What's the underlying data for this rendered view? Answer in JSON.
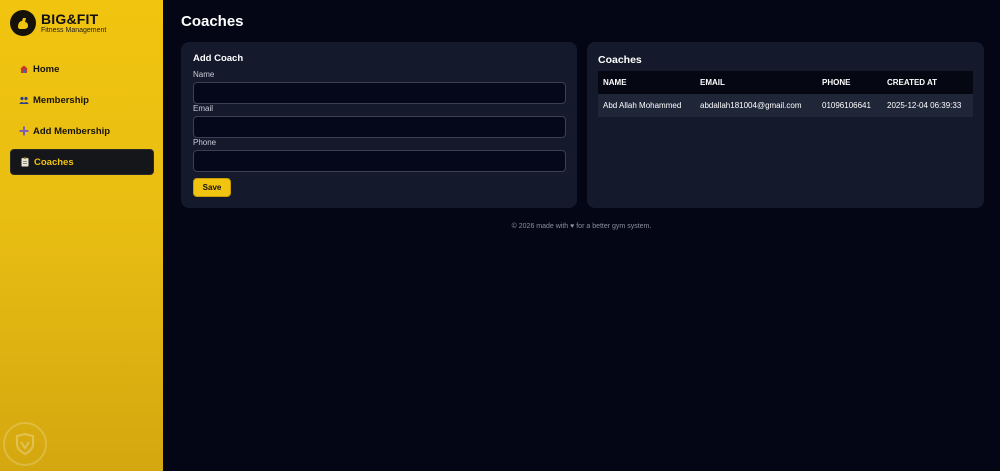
{
  "brand": {
    "title": "BIG&FIT",
    "subtitle": "Fitness Management"
  },
  "sidebar": {
    "items": [
      {
        "label": "Home",
        "icon": "house-icon",
        "active": false
      },
      {
        "label": "Membership",
        "icon": "members-icon",
        "active": false
      },
      {
        "label": "Add Membership",
        "icon": "plus-icon",
        "active": false
      },
      {
        "label": "Coaches",
        "icon": "clipboard-icon",
        "active": true
      }
    ]
  },
  "page": {
    "title": "Coaches"
  },
  "form": {
    "title": "Add Coach",
    "fields": [
      {
        "label": "Name",
        "value": ""
      },
      {
        "label": "Email",
        "value": ""
      },
      {
        "label": "Phone",
        "value": ""
      }
    ],
    "save_label": "Save"
  },
  "table": {
    "title": "Coaches",
    "columns": [
      "NAME",
      "EMAIL",
      "PHONE",
      "CREATED AT"
    ],
    "rows": [
      [
        "Abd Allah Mohammed",
        "abdallah181004@gmail.com",
        "01096106641",
        "2025-12-04 06:39:33"
      ]
    ]
  },
  "footer": {
    "text": "© 2026 made with ♥ for a better gym system."
  },
  "colors": {
    "accent": "#f1c40f",
    "background": "#040616",
    "card": "#141a2c"
  }
}
